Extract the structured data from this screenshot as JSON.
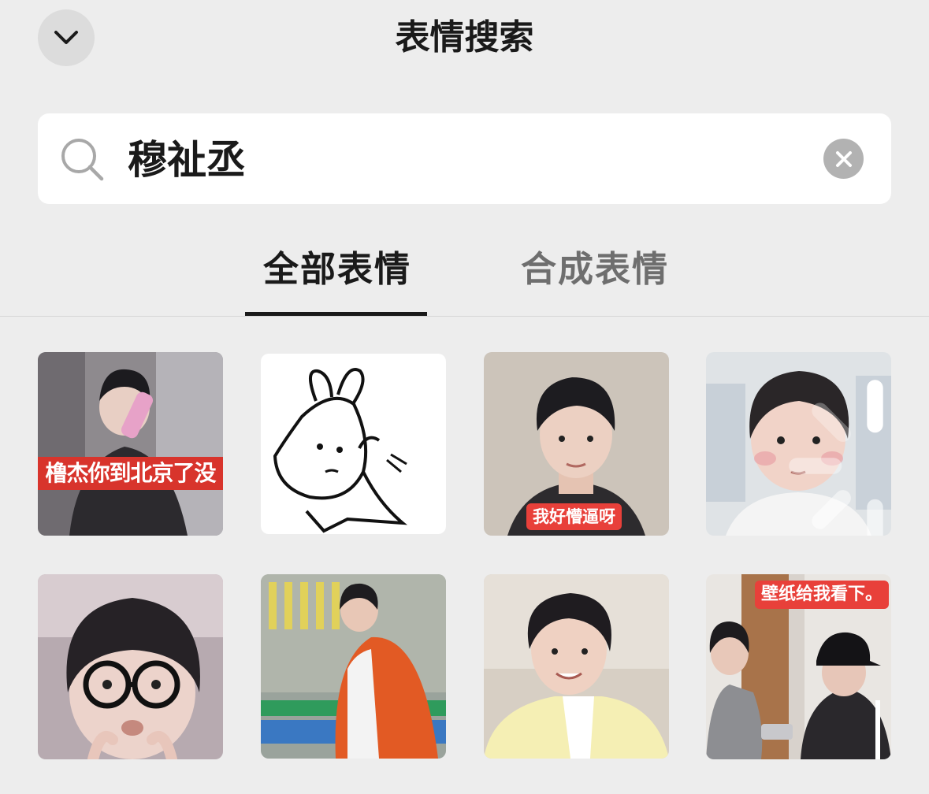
{
  "header": {
    "title": "表情搜索",
    "back_icon": "chevron-down-icon"
  },
  "search": {
    "value": "穆祉丞",
    "search_icon": "search-icon",
    "clear_icon": "clear-icon"
  },
  "tabs": [
    {
      "label": "全部表情",
      "active": true
    },
    {
      "label": "合成表情",
      "active": false
    }
  ],
  "stickers": [
    {
      "caption": "橹杰你到北京了没"
    },
    {
      "caption": ""
    },
    {
      "caption": "我好懵逼呀"
    },
    {
      "caption": ""
    },
    {
      "caption": ""
    },
    {
      "caption": ""
    },
    {
      "caption": ""
    },
    {
      "caption": "壁纸给我看下。"
    }
  ],
  "colors": {
    "background": "#ededed",
    "caption_red": "#d8342c",
    "tab_active": "#1a1a1a",
    "tab_inactive": "#6e6e6e"
  }
}
